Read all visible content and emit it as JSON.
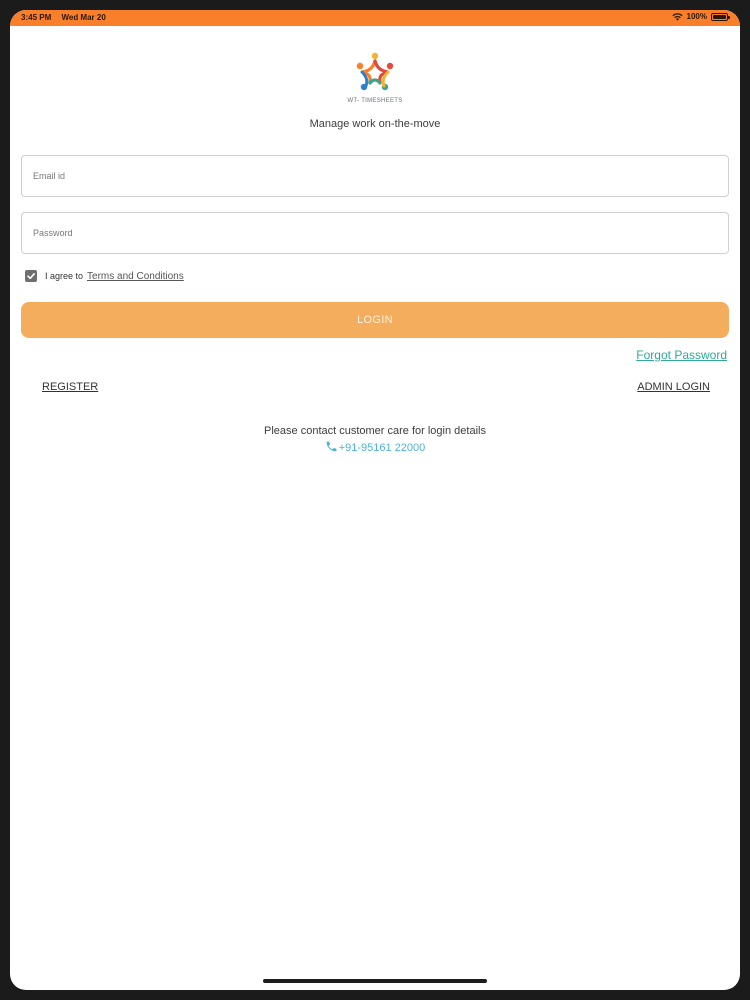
{
  "status_bar": {
    "time": "3:45 PM",
    "date": "Wed Mar 20",
    "battery": "100%",
    "icons": [
      "wifi-icon",
      "battery-icon"
    ]
  },
  "brand": {
    "logo_text": "WT- TIMESHEETS",
    "tagline": "Manage work on-the-move",
    "colors": {
      "orange": "#f97f2b",
      "blue": "#2f7fd1",
      "green": "#3aa58a",
      "yellow": "#f2b233",
      "red": "#e24b3b"
    }
  },
  "form": {
    "email_placeholder": "Email id",
    "email_value": "",
    "password_placeholder": "Password",
    "password_value": "",
    "agree_prefix": "I agree to",
    "terms_label": "Terms and Conditions",
    "agree_checked": true,
    "login_label": "LOGIN"
  },
  "links": {
    "forgot_password": "Forgot Password",
    "register": "REGISTER",
    "admin_login": "ADMIN LOGIN"
  },
  "contact": {
    "text": "Please contact customer care for login details",
    "phone": "+91-95161 22000",
    "icon": "phone-icon"
  },
  "colors": {
    "status_bar": "#f97f2b",
    "login_button": "#f4ad5c",
    "forgot_link": "#30a89a",
    "phone_link": "#4db3d9"
  }
}
